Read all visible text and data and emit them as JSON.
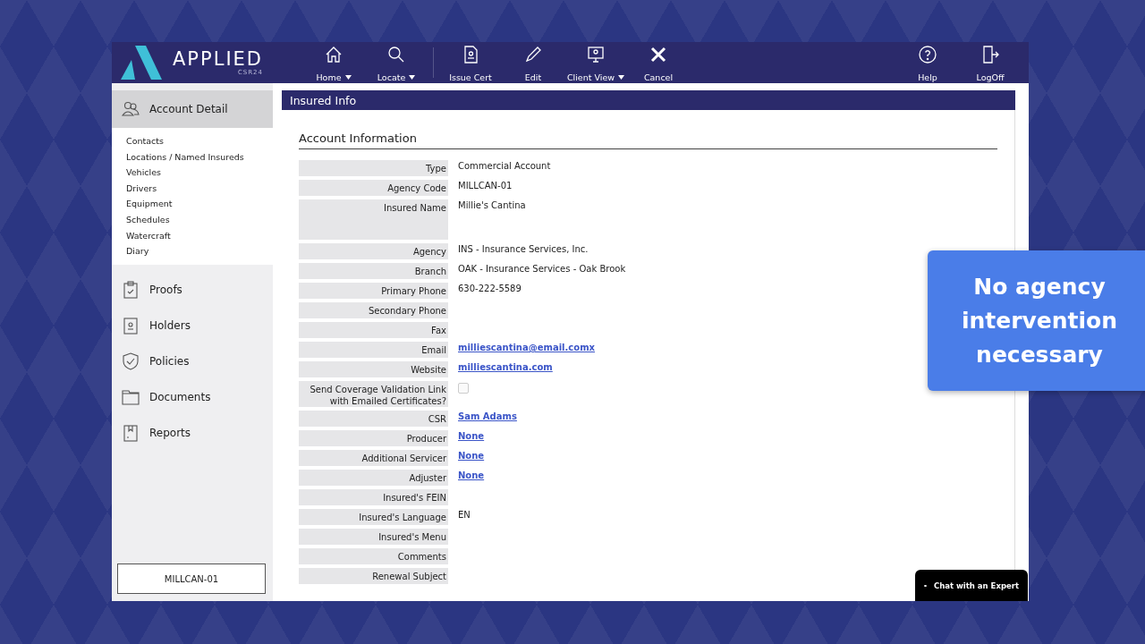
{
  "app": {
    "logo": "APPLIED",
    "logo_subtitle": "CSR24"
  },
  "toolbar": {
    "groups": [
      [
        {
          "label": "Home",
          "dropdown": true
        },
        {
          "label": "Locate",
          "dropdown": true
        }
      ],
      [
        {
          "label": "Issue Cert",
          "dropdown": false
        },
        {
          "label": "Edit",
          "dropdown": false
        },
        {
          "label": "Client View",
          "dropdown": true
        },
        {
          "label": "Cancel",
          "dropdown": false
        }
      ]
    ],
    "right": [
      {
        "label": "Help"
      },
      {
        "label": "LogOff"
      }
    ]
  },
  "sidebar": {
    "sections": [
      {
        "label": "Account Detail",
        "selected": true,
        "children": [
          "Contacts",
          "Locations / Named Insureds",
          "Vehicles",
          "Drivers",
          "Equipment",
          "Schedules",
          "Watercraft",
          "Diary"
        ]
      },
      {
        "label": "Proofs",
        "selected": false
      },
      {
        "label": "Holders",
        "selected": false
      },
      {
        "label": "Policies",
        "selected": false
      },
      {
        "label": "Documents",
        "selected": false
      },
      {
        "label": "Reports",
        "selected": false
      }
    ],
    "account_code": "MILLCAN-01"
  },
  "panel": {
    "title": "Insured Info",
    "section_title": "Account Information",
    "fields": [
      {
        "label": "Type",
        "kind": "text",
        "value": "Commercial Account"
      },
      {
        "label": "Agency Code",
        "kind": "text",
        "value": "MILLCAN-01"
      },
      {
        "label": "Insured Name",
        "kind": "multiline",
        "value": "Millie's Cantina"
      },
      {
        "label": "Agency",
        "kind": "text",
        "value": "INS - Insurance Services, Inc."
      },
      {
        "label": "Branch",
        "kind": "text",
        "value": "OAK - Insurance Services - Oak Brook"
      },
      {
        "label": "Primary Phone",
        "kind": "text",
        "value": "630-222-5589"
      },
      {
        "label": "Secondary Phone",
        "kind": "empty"
      },
      {
        "label": "Fax",
        "kind": "empty"
      },
      {
        "label": "Email",
        "kind": "link",
        "value": "milliescantina@email.comx"
      },
      {
        "label": "Website",
        "kind": "link",
        "value": "milliescantina.com"
      },
      {
        "label": "Send Coverage Validation Link\nwith Emailed Certificates?",
        "kind": "checkbox",
        "checked": false
      },
      {
        "label": "CSR",
        "kind": "link",
        "value": "Sam Adams"
      },
      {
        "label": "Producer",
        "kind": "link",
        "value": "None"
      },
      {
        "label": "Additional Servicer",
        "kind": "link",
        "value": "None"
      },
      {
        "label": "Adjuster",
        "kind": "link",
        "value": "None"
      },
      {
        "label": "Insured's FEIN",
        "kind": "empty"
      },
      {
        "label": "Insured's Language",
        "kind": "text",
        "value": "EN"
      },
      {
        "label": "Insured's Menu",
        "kind": "empty"
      },
      {
        "label": "Comments",
        "kind": "empty"
      },
      {
        "label": "Renewal Subject",
        "kind": "empty"
      }
    ]
  },
  "callout": {
    "text": "No agency intervention necessary"
  },
  "chat_button": {
    "label": "Chat with an Expert"
  }
}
